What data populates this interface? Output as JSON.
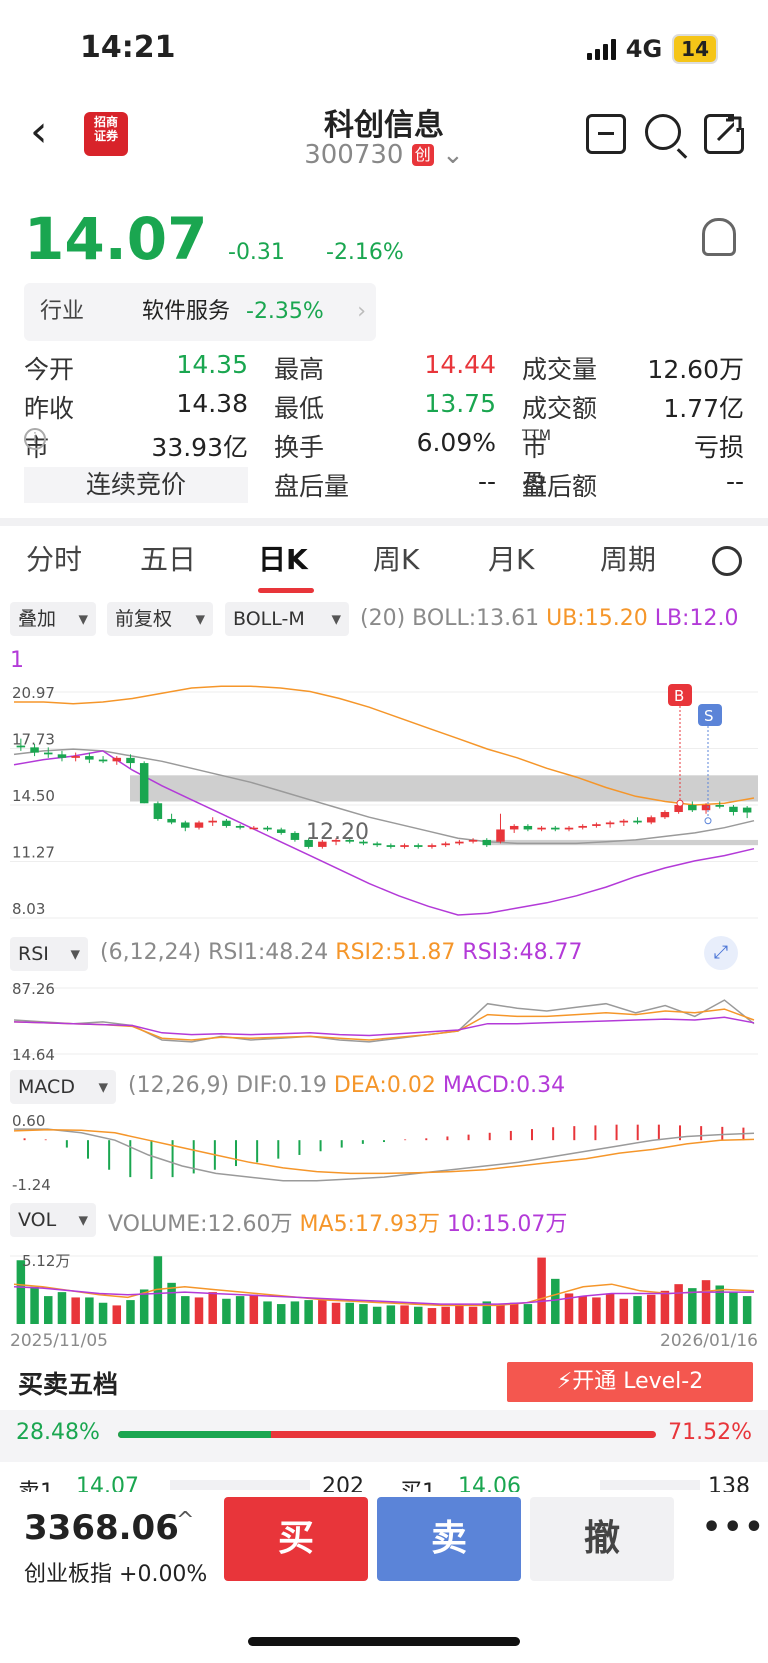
{
  "status": {
    "time": "14:21",
    "network": "4G",
    "battery": "14"
  },
  "header": {
    "name": "科创信息",
    "code": "300730",
    "board_badge": "创",
    "logo_text": "招商证券"
  },
  "quote": {
    "price": "14.07",
    "change": "-0.31",
    "change_pct": "-2.16%"
  },
  "industry": {
    "label": "行业",
    "name": "软件服务",
    "pct": "-2.35%"
  },
  "stats": {
    "open_label": "今开",
    "open": "14.35",
    "high_label": "最高",
    "high": "14.44",
    "volume_label": "成交量",
    "volume": "12.60万",
    "prev_label": "昨收",
    "prev": "14.38",
    "low_label": "最低",
    "low": "13.75",
    "amount_label": "成交额",
    "amount": "1.77亿",
    "mcap_label": "市值",
    "mcap": "33.93亿",
    "turnover_label": "换手",
    "turnover": "6.09%",
    "pe_label": "市盈",
    "pe_sup": "TTM",
    "pe": "亏损",
    "auction": "连续竞价",
    "after_vol_label": "盘后量",
    "after_vol": "--",
    "after_amt_label": "盘后额",
    "after_amt": "--"
  },
  "tabs": [
    "分时",
    "五日",
    "日K",
    "周K",
    "月K",
    "周期"
  ],
  "controls": {
    "overlay": "叠加",
    "adjust": "前复权",
    "indicator": "BOLL-M"
  },
  "boll": {
    "params": "(20)",
    "boll": "BOLL:13.61",
    "ub": "UB:15.20",
    "lb_line1": "LB:12.0",
    "lb_line2": "1"
  },
  "kchart": {
    "y_labels": [
      "20.97",
      "17.73",
      "14.50",
      "11.27",
      "8.03"
    ],
    "annotation": "12.20",
    "buy_marker": "B",
    "sell_marker": "S"
  },
  "rsi": {
    "label": "RSI",
    "params": "(6,12,24)",
    "rsi1": "RSI1:48.24",
    "rsi2": "RSI2:51.87",
    "rsi3": "RSI3:48.77",
    "y_top": "87.26",
    "y_bottom": "14.64"
  },
  "macd": {
    "label": "MACD",
    "params": "(12,26,9)",
    "dif": "DIF:0.19",
    "dea": "DEA:0.02",
    "macd": "MACD:0.34",
    "y_top": "0.60",
    "y_bottom": "-1.24"
  },
  "vol": {
    "label": "VOL",
    "volume": "VOLUME:12.60万",
    "ma5": "MA5:17.93万",
    "ma10": "10:15.07万",
    "y_top": "5.12万"
  },
  "dates": {
    "start": "2025/11/05",
    "end": "2026/01/16"
  },
  "orderbook": {
    "title": "买卖五档",
    "level2": "开通 Level-2",
    "sell_ratio": "28.48%",
    "buy_ratio": "71.52%",
    "sell_ratio_value": 28.48,
    "ask1_label": "卖1",
    "ask1_price": "14.07",
    "ask1_vol": "202",
    "bid1_label": "买1",
    "bid1_price": "14.06",
    "bid1_vol": "138"
  },
  "bottom": {
    "index_value": "3368.06",
    "index_name": "创业板指",
    "index_change": "+0.00%",
    "buy": "买",
    "sell": "卖",
    "cancel": "撤"
  },
  "colors": {
    "up": "#e8353a",
    "down": "#1aa650",
    "ub": "#f5962a",
    "lb": "#b33ad8",
    "mid": "#9a9a9a"
  },
  "chart_data": {
    "type": "candlestick",
    "candles": [
      [
        17.9,
        18.3,
        17.6,
        17.8
      ],
      [
        17.8,
        18.0,
        17.3,
        17.5
      ],
      [
        17.5,
        17.8,
        17.2,
        17.4
      ],
      [
        17.4,
        17.6,
        17.0,
        17.2
      ],
      [
        17.2,
        17.5,
        17.0,
        17.3
      ],
      [
        17.3,
        17.5,
        16.9,
        17.1
      ],
      [
        17.1,
        17.3,
        16.9,
        17.0
      ],
      [
        17.0,
        17.3,
        16.8,
        17.2
      ],
      [
        17.2,
        17.4,
        16.6,
        16.9
      ],
      [
        16.9,
        17.0,
        14.6,
        14.6
      ],
      [
        14.6,
        14.7,
        13.6,
        13.7
      ],
      [
        13.7,
        14.0,
        13.4,
        13.5
      ],
      [
        13.5,
        13.6,
        13.0,
        13.2
      ],
      [
        13.2,
        13.6,
        13.1,
        13.5
      ],
      [
        13.5,
        13.8,
        13.3,
        13.6
      ],
      [
        13.6,
        13.7,
        13.2,
        13.3
      ],
      [
        13.3,
        13.4,
        13.1,
        13.2
      ],
      [
        13.2,
        13.3,
        13.1,
        13.2
      ],
      [
        13.2,
        13.3,
        13.0,
        13.1
      ],
      [
        13.1,
        13.2,
        12.8,
        12.9
      ],
      [
        12.9,
        13.0,
        12.4,
        12.5
      ],
      [
        12.5,
        12.6,
        12.0,
        12.1
      ],
      [
        12.1,
        12.5,
        12.0,
        12.4
      ],
      [
        12.4,
        12.6,
        12.2,
        12.5
      ],
      [
        12.5,
        12.6,
        12.3,
        12.4
      ],
      [
        12.4,
        12.5,
        12.2,
        12.3
      ],
      [
        12.3,
        12.4,
        12.1,
        12.2
      ],
      [
        12.2,
        12.3,
        12.0,
        12.1
      ],
      [
        12.1,
        12.3,
        12.0,
        12.2
      ],
      [
        12.2,
        12.3,
        12.0,
        12.1
      ],
      [
        12.1,
        12.3,
        12.0,
        12.2
      ],
      [
        12.2,
        12.4,
        12.1,
        12.3
      ],
      [
        12.3,
        12.5,
        12.2,
        12.4
      ],
      [
        12.4,
        12.6,
        12.3,
        12.5
      ],
      [
        12.5,
        12.6,
        12.1,
        12.2
      ],
      [
        12.4,
        14.0,
        12.3,
        13.1
      ],
      [
        13.1,
        13.4,
        12.9,
        13.3
      ],
      [
        13.3,
        13.4,
        13.0,
        13.1
      ],
      [
        13.1,
        13.3,
        13.0,
        13.2
      ],
      [
        13.2,
        13.3,
        13.0,
        13.1
      ],
      [
        13.1,
        13.3,
        13.0,
        13.2
      ],
      [
        13.2,
        13.4,
        13.1,
        13.3
      ],
      [
        13.3,
        13.5,
        13.2,
        13.4
      ],
      [
        13.4,
        13.6,
        13.2,
        13.5
      ],
      [
        13.5,
        13.7,
        13.3,
        13.6
      ],
      [
        13.6,
        13.8,
        13.4,
        13.5
      ],
      [
        13.5,
        13.9,
        13.4,
        13.8
      ],
      [
        13.8,
        14.2,
        13.7,
        14.1
      ],
      [
        14.1,
        14.6,
        14.0,
        14.5
      ],
      [
        14.5,
        14.7,
        14.1,
        14.2
      ],
      [
        14.2,
        14.6,
        14.0,
        14.5
      ],
      [
        14.5,
        14.7,
        14.3,
        14.4
      ],
      [
        14.4,
        14.5,
        13.9,
        14.1
      ],
      [
        14.35,
        14.44,
        13.75,
        14.07
      ]
    ],
    "ub": [
      20.4,
      20.4,
      20.3,
      20.4,
      20.6,
      20.9,
      21.2,
      21.3,
      21.3,
      21.2,
      21.0,
      20.6,
      20.1,
      19.5,
      18.9,
      18.3,
      17.7,
      17.2,
      16.6,
      16.1,
      15.5,
      15.0,
      14.7,
      14.5,
      14.6,
      14.9
    ],
    "mid": [
      17.4,
      17.6,
      17.7,
      17.6,
      17.3,
      17.0,
      16.6,
      16.2,
      15.8,
      15.3,
      14.8,
      14.3,
      13.8,
      13.4,
      13.0,
      12.6,
      12.4,
      12.3,
      12.3,
      12.3,
      12.4,
      12.5,
      12.7,
      12.9,
      13.2,
      13.6
    ],
    "lb": [
      16.8,
      17.1,
      17.3,
      17.6,
      16.5,
      15.6,
      14.8,
      14.0,
      13.2,
      12.4,
      11.6,
      10.8,
      10.0,
      9.3,
      8.7,
      8.2,
      8.3,
      8.6,
      8.9,
      9.3,
      9.8,
      10.4,
      10.9,
      11.3,
      11.6,
      12.0
    ],
    "rsi1": [
      52,
      50,
      48,
      50,
      46,
      30,
      28,
      34,
      30,
      32,
      34,
      30,
      28,
      32,
      36,
      40,
      70,
      65,
      62,
      66,
      70,
      60,
      68,
      56,
      74,
      48
    ],
    "rsi2": [
      50,
      49,
      48,
      47,
      45,
      32,
      30,
      33,
      32,
      33,
      34,
      32,
      30,
      33,
      36,
      40,
      58,
      56,
      56,
      58,
      60,
      58,
      62,
      60,
      64,
      52
    ],
    "rsi3": [
      50,
      49,
      48,
      47,
      46,
      38,
      36,
      37,
      36,
      37,
      38,
      36,
      35,
      37,
      39,
      41,
      48,
      48,
      49,
      50,
      51,
      52,
      53,
      52,
      55,
      49
    ],
    "macd_hist": [
      0.05,
      0.02,
      -0.2,
      -0.5,
      -0.8,
      -1.0,
      -1.05,
      -1.0,
      -0.9,
      -0.8,
      -0.7,
      -0.6,
      -0.5,
      -0.4,
      -0.3,
      -0.2,
      -0.1,
      -0.05,
      0.02,
      0.05,
      0.1,
      0.15,
      0.2,
      0.25,
      0.3,
      0.35,
      0.38,
      0.4,
      0.42,
      0.42,
      0.42,
      0.4,
      0.38,
      0.36,
      0.34
    ],
    "dif": [
      0.3,
      0.3,
      0.2,
      0.0,
      -0.4,
      -0.7,
      -0.9,
      -1.0,
      -1.1,
      -1.1,
      -1.05,
      -1.0,
      -0.9,
      -0.8,
      -0.7,
      -0.6,
      -0.45,
      -0.3,
      -0.15,
      0.0,
      0.1,
      0.15,
      0.19
    ],
    "dea": [
      0.25,
      0.28,
      0.27,
      0.2,
      0.0,
      -0.2,
      -0.4,
      -0.6,
      -0.75,
      -0.85,
      -0.9,
      -0.9,
      -0.88,
      -0.85,
      -0.8,
      -0.7,
      -0.6,
      -0.5,
      -0.35,
      -0.25,
      -0.1,
      0.0,
      0.02
    ],
    "volume": [
      4.8,
      2.8,
      2.1,
      2.4,
      2.0,
      2.0,
      1.6,
      1.4,
      1.8,
      2.6,
      5.1,
      3.1,
      2.1,
      2.0,
      2.4,
      1.9,
      2.1,
      2.2,
      1.7,
      1.5,
      1.7,
      1.8,
      1.8,
      1.6,
      1.6,
      1.5,
      1.3,
      1.4,
      1.4,
      1.3,
      1.2,
      1.3,
      1.5,
      1.3,
      1.7,
      1.4,
      1.6,
      1.5,
      5.0,
      3.4,
      2.3,
      2.1,
      2.0,
      2.3,
      1.9,
      2.1,
      2.2,
      2.5,
      3.0,
      2.7,
      3.3,
      2.9,
      2.4,
      2.1
    ],
    "ma5": [
      3.0,
      2.8,
      2.5,
      2.2,
      2.0,
      2.6,
      2.8,
      2.6,
      2.4,
      2.2,
      2.0,
      1.8,
      1.7,
      1.6,
      1.5,
      1.4,
      1.4,
      1.4,
      1.6,
      2.2,
      2.8,
      3.0,
      2.5,
      2.3,
      2.4,
      2.6,
      2.5
    ],
    "ma10": [
      2.8,
      2.7,
      2.5,
      2.3,
      2.2,
      2.3,
      2.4,
      2.3,
      2.2,
      2.1,
      2.0,
      1.9,
      1.8,
      1.7,
      1.6,
      1.5,
      1.5,
      1.5,
      1.6,
      1.8,
      2.1,
      2.3,
      2.3,
      2.3,
      2.4,
      2.4,
      2.4
    ]
  }
}
